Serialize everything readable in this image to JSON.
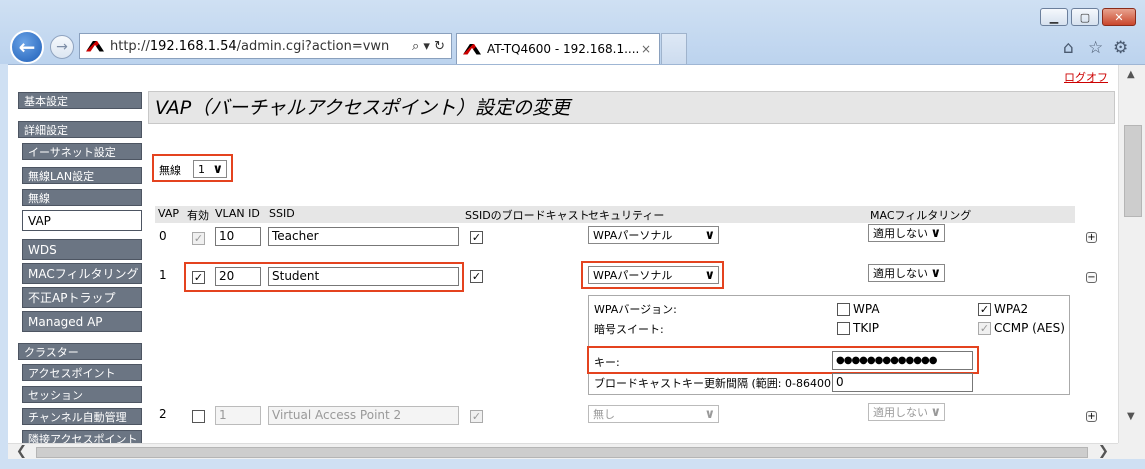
{
  "browser": {
    "url_prefix": "http://",
    "url_host": "192.168.1.54",
    "url_path": "/admin.cgi?action=vwn",
    "tab_title": "AT-TQ4600 - 192.168.1....",
    "tab_close": "×",
    "icons": [
      "back-icon",
      "forward-icon",
      "search-icon",
      "refresh-icon",
      "home-icon",
      "favorites-star-icon",
      "settings-gear-icon"
    ]
  },
  "page": {
    "logout": "ログオフ",
    "title": "VAP（バーチャルアクセスポイント）設定の変更",
    "radio_label": "無線",
    "radio_value": "1"
  },
  "sidebar": {
    "basic": "基本設定",
    "advanced": "詳細設定",
    "items": [
      "イーサネット設定",
      "無線LAN設定",
      "無線",
      "VAP",
      "WDS",
      "MACフィルタリング",
      "不正APトラップ",
      "Managed AP"
    ],
    "cluster": "クラスター",
    "cluster_items": [
      "アクセスポイント",
      "セッション",
      "チャンネル自動管理",
      "隣接アクセスポイント"
    ]
  },
  "table": {
    "headers": [
      "VAP",
      "有効",
      "VLAN ID",
      "SSID",
      "SSIDのブロードキャスト",
      "セキュリティー",
      "MACフィルタリング"
    ],
    "rows": [
      {
        "vap": "0",
        "vlan": "10",
        "ssid": "Teacher",
        "security": "WPAパーソナル",
        "mac": "適用しない",
        "enabled": true,
        "broadcast": true,
        "toggle": "+"
      },
      {
        "vap": "1",
        "vlan": "20",
        "ssid": "Student",
        "security": "WPAパーソナル",
        "mac": "適用しない",
        "enabled": true,
        "broadcast": true,
        "toggle": "−"
      },
      {
        "vap": "2",
        "vlan": "1",
        "ssid": "Virtual Access Point 2",
        "security": "無し",
        "mac": "適用しない",
        "enabled": false,
        "broadcast": true,
        "toggle": "+"
      }
    ]
  },
  "wpa": {
    "version_label": "WPAバージョン:",
    "wpa": "WPA",
    "wpa2": "WPA2",
    "cipher_label": "暗号スイート:",
    "tkip": "TKIP",
    "ccmp": "CCMP (AES)",
    "key_label": "キー:",
    "key_value": "●●●●●●●●●●●●●",
    "rekey_label": "ブロードキャストキー更新間隔 (範囲: 0-86400)",
    "rekey_value": "0"
  }
}
